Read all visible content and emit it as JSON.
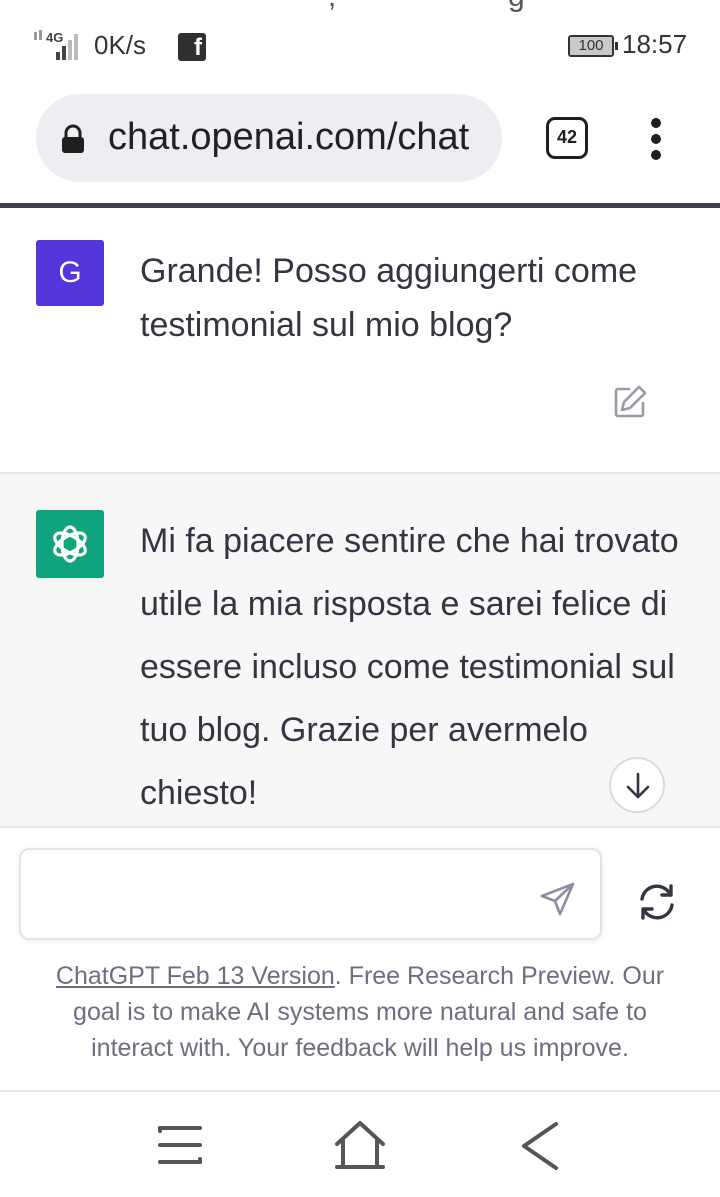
{
  "status_bar": {
    "network": "4G",
    "net_speed": "0K/s",
    "notification_app": "facebook-icon",
    "battery": "100",
    "time": "18:57"
  },
  "browser": {
    "url": "chat.openai.com/chat",
    "tab_count": "42"
  },
  "conversation": {
    "user": {
      "avatar_letter": "G",
      "avatar_color": "#5436da",
      "text": "Grande! Posso aggiungerti come testimonial sul mio blog?"
    },
    "assistant": {
      "avatar_color": "#10a37f",
      "text": "Mi fa piacere sentire che hai trovato utile la mia risposta e sarei felice di essere incluso come testimonial sul tuo blog. Grazie per avermelo chiesto!"
    }
  },
  "composer": {
    "input_value": "",
    "placeholder": ""
  },
  "footer": {
    "version_link": "ChatGPT Feb 13 Version",
    "note": ". Free Research Preview. Our goal is to make AI systems more natural and safe to interact with. Your feedback will help us improve."
  },
  "colors": {
    "user_avatar": "#5436da",
    "assistant_avatar": "#10a37f",
    "assistant_bg": "#f7f7f8"
  }
}
